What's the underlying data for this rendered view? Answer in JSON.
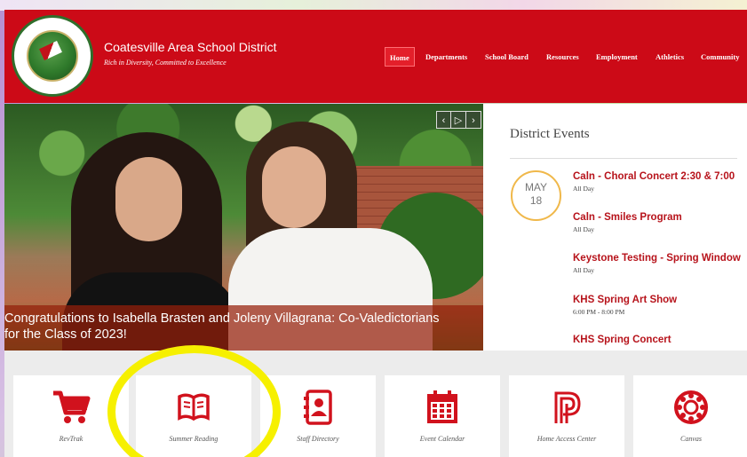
{
  "header": {
    "district_name": "Coatesville Area School District",
    "tagline": "Rich in Diversity, Committed to Excellence",
    "seal_text": "COATESVILLE AREA SCHOOL DISTRICT 1877",
    "accent_color": "#cc0a17"
  },
  "nav": {
    "items": [
      {
        "label": "Home",
        "active": true
      },
      {
        "label": "Departments"
      },
      {
        "label": "School Board"
      },
      {
        "label": "Resources"
      },
      {
        "label": "Employment"
      },
      {
        "label": "Athletics"
      },
      {
        "label": "Community"
      }
    ]
  },
  "slideshow": {
    "caption": "Congratulations to Isabella Brasten and Joleny Villagrana: Co-Valedictorians for the Class of 2023!",
    "caption_line1": "Congratulations to Isabella Brasten and Joleny Villagrana: Co-Valedictorians",
    "caption_line2": "for the Class of 2023!",
    "controls": {
      "prev": "‹",
      "play": "▷",
      "next": "›"
    }
  },
  "events": {
    "title": "District Events",
    "date": {
      "month": "MAY",
      "day": "18"
    },
    "items": [
      {
        "title": "Caln - Choral Concert 2:30 & 7:00",
        "time": "All Day"
      },
      {
        "title": "Caln - Smiles Program",
        "time": "All Day"
      },
      {
        "title": "Keystone Testing - Spring Window",
        "time": "All Day"
      },
      {
        "title": "KHS Spring Art Show",
        "time": "6:00 PM - 8:00 PM"
      },
      {
        "title": "KHS Spring Concert",
        "time": ""
      }
    ]
  },
  "quick_links": [
    {
      "label": "RevTrak",
      "icon": "cart-icon"
    },
    {
      "label": "Summer Reading",
      "icon": "book-icon"
    },
    {
      "label": "Staff Directory",
      "icon": "contact-book-icon"
    },
    {
      "label": "Event Calendar",
      "icon": "calendar-icon"
    },
    {
      "label": "Home Access Center",
      "icon": "powerschool-p-icon"
    },
    {
      "label": "Canvas",
      "icon": "canvas-icon"
    }
  ],
  "icon_color": "#d1121d",
  "annotation_color": "#f6f000"
}
